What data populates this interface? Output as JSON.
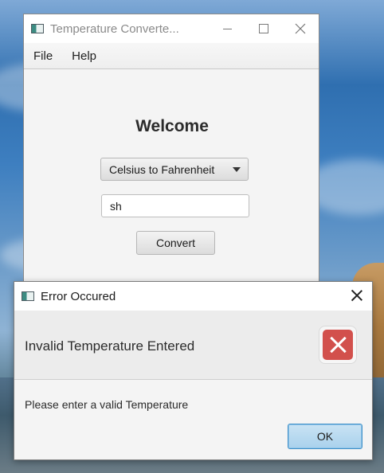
{
  "main_window": {
    "title": "Temperature Converte...",
    "menu": [
      "File",
      "Help"
    ],
    "heading": "Welcome",
    "conversion_select": {
      "selected": "Celsius to Fahrenheit"
    },
    "temperature_input": {
      "value": "sh"
    },
    "convert_button": "Convert"
  },
  "error_dialog": {
    "title": "Error Occured",
    "header_text": "Invalid Temperature Entered",
    "message": "Please enter a valid Temperature",
    "ok_button": "OK"
  }
}
